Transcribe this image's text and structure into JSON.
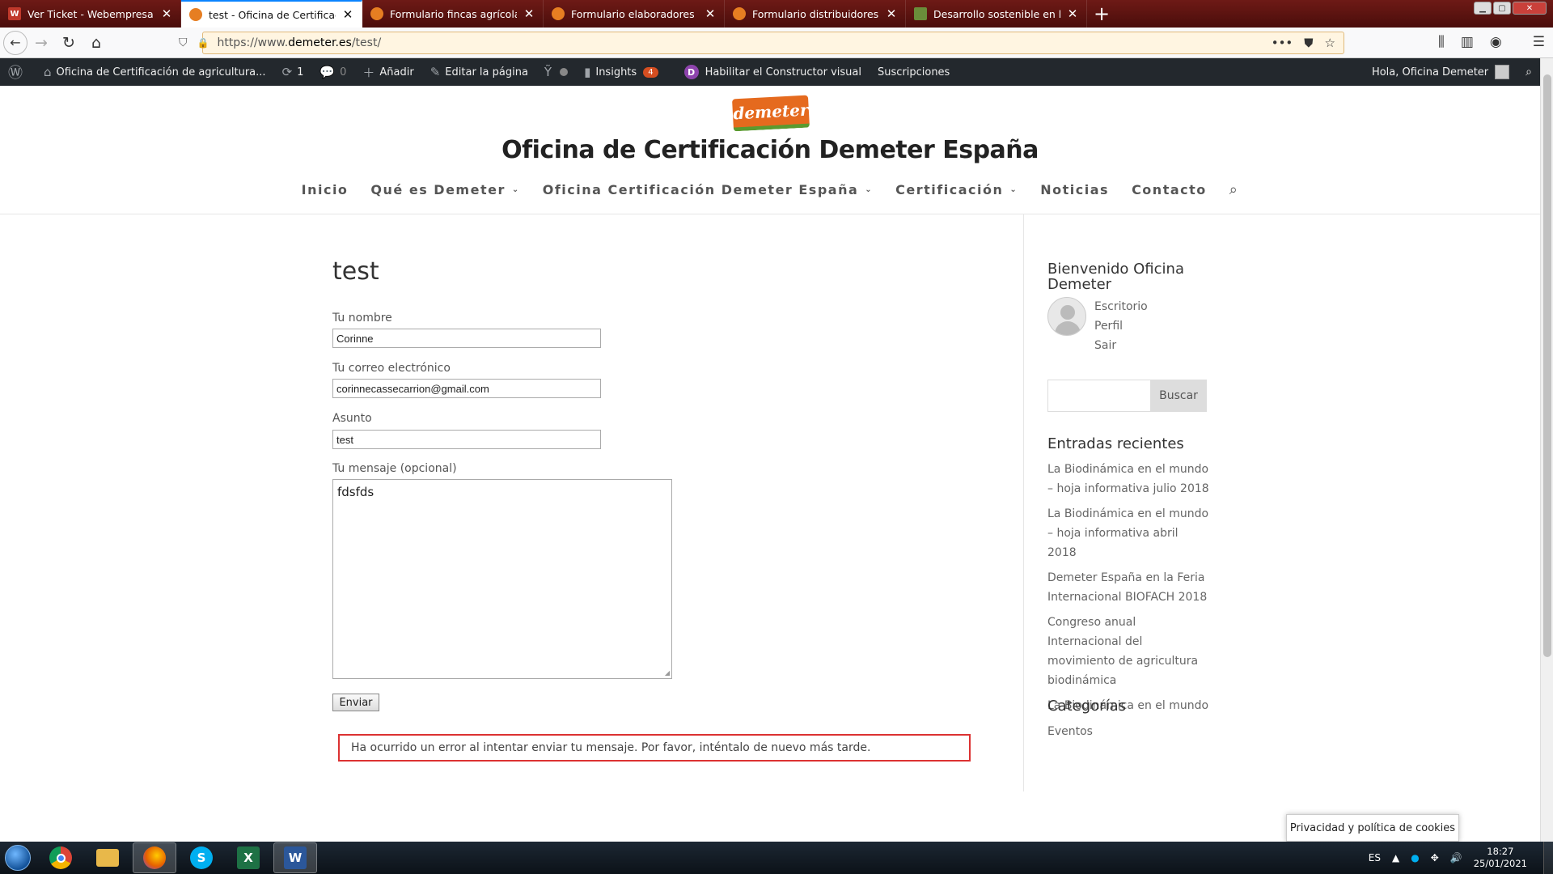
{
  "browser": {
    "tabs": [
      {
        "title": "Ver Ticket - Webempresa Europa",
        "favicon_color": "#c0392b",
        "favicon_letter": "W",
        "active": false
      },
      {
        "title": "test - Oficina de Certificación de",
        "favicon_color": "#e67e22",
        "favicon_letter": "",
        "active": true
      },
      {
        "title": "Formulario fincas agrícolas y/o",
        "favicon_color": "#e67e22",
        "favicon_letter": "",
        "active": false
      },
      {
        "title": "Formulario elaboradores - Oficina",
        "favicon_color": "#e67e22",
        "favicon_letter": "",
        "active": false
      },
      {
        "title": "Formulario distribuidores - Oficina",
        "favicon_color": "#e67e22",
        "favicon_letter": "",
        "active": false
      },
      {
        "title": "Desarrollo sostenible en la sierra",
        "favicon_color": "#6a8d3a",
        "favicon_letter": "",
        "active": false
      }
    ],
    "url_prefix": "https://www.",
    "url_domain": "demeter.es",
    "url_path": "/test/"
  },
  "adminbar": {
    "site_name": "Oficina de Certificación de agricultura...",
    "updates_count": "1",
    "comments_count": "0",
    "add_label": "Añadir",
    "edit_label": "Editar la página",
    "insights_label": "Insights",
    "insights_badge": "4",
    "builder_label": "Habilitar el Constructor visual",
    "subscriptions_label": "Suscripciones",
    "greeting": "Hola, Oficina Demeter"
  },
  "site": {
    "logo_text": "demeter",
    "title": "Oficina de Certificación Demeter España",
    "nav": [
      {
        "label": "Inicio",
        "dropdown": false
      },
      {
        "label": "Qué es Demeter",
        "dropdown": true
      },
      {
        "label": "Oficina Certificación Demeter España",
        "dropdown": true
      },
      {
        "label": "Certificación",
        "dropdown": true
      },
      {
        "label": "Noticias",
        "dropdown": false
      },
      {
        "label": "Contacto",
        "dropdown": false
      }
    ]
  },
  "page": {
    "title": "test",
    "form": {
      "name_label": "Tu nombre",
      "name_value": "Corinne",
      "email_label": "Tu correo electrónico",
      "email_value": "corinnecassecarrion@gmail.com",
      "subject_label": "Asunto",
      "subject_value": "test",
      "message_label": "Tu mensaje (opcional)",
      "message_value": "fdsfds",
      "submit_label": "Enviar",
      "error_message": "Ha ocurrido un error al intentar enviar tu mensaje. Por favor, inténtalo de nuevo más tarde."
    }
  },
  "sidebar": {
    "welcome_title": "Bienvenido Oficina Demeter",
    "user_links": [
      "Escritorio",
      "Perfil",
      "Sair"
    ],
    "search_button": "Buscar",
    "recent_title": "Entradas recientes",
    "recent_posts": [
      "La Biodinámica en el mundo – hoja informativa julio 2018",
      "La Biodinámica en el mundo – hoja informativa abril 2018",
      "Demeter España en la Feria Internacional BIOFACH 2018",
      "Congreso anual Internacional del movimiento de agricultura biodinámica",
      "La Biodinámica en el mundo"
    ],
    "categories_title": "Categorías",
    "categories": [
      "Eventos"
    ]
  },
  "cookie_label": "Privacidad y política de cookies",
  "taskbar": {
    "apps": [
      {
        "name": "chrome",
        "color": "#dd4b39",
        "letter": "",
        "active": false
      },
      {
        "name": "explorer",
        "color": "#e8b84a",
        "letter": "",
        "active": false
      },
      {
        "name": "firefox",
        "color": "#e66000",
        "letter": "",
        "active": true
      },
      {
        "name": "skype",
        "color": "#00aff0",
        "letter": "S",
        "active": false
      },
      {
        "name": "excel",
        "color": "#1e7145",
        "letter": "X",
        "active": false
      },
      {
        "name": "word",
        "color": "#2b579a",
        "letter": "W",
        "active": true
      }
    ],
    "lang": "ES",
    "time": "18:27",
    "date": "25/01/2021"
  }
}
